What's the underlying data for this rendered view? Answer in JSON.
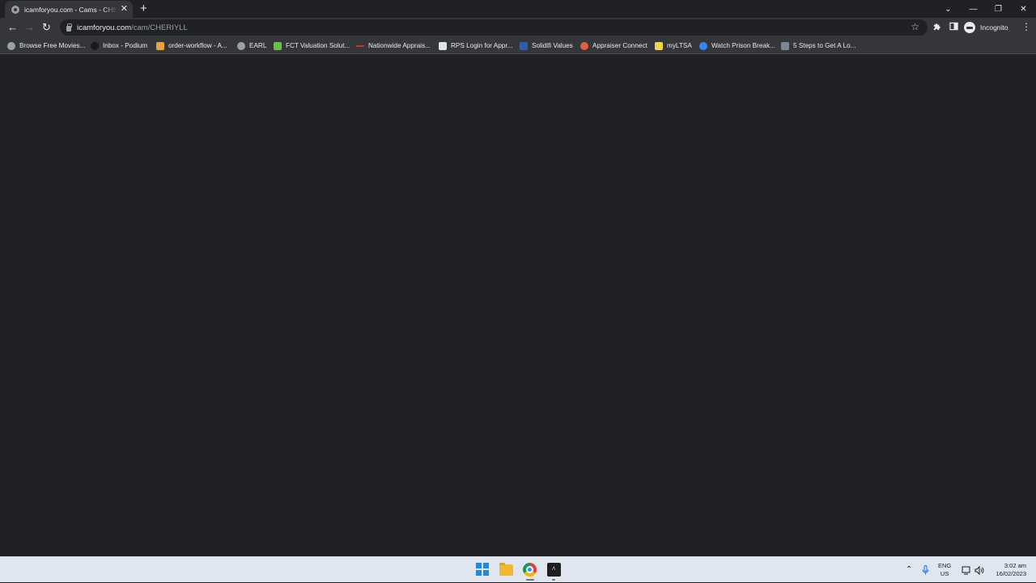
{
  "tab": {
    "title": "icamforyou.com - Cams - CHERIYLL",
    "close_glyph": "✕",
    "favicon": "globe-icon"
  },
  "new_tab_glyph": "+",
  "window_controls": {
    "tabsearch": "⌄",
    "minimize": "—",
    "restore": "❐",
    "close": "✕"
  },
  "toolbar": {
    "back": "←",
    "forward": "→",
    "reload": "↻",
    "url_host": "icamforyou.com",
    "url_path": "/cam/CHERIYLL",
    "star": "☆",
    "incognito_label": "Incognito",
    "menu": "⋮"
  },
  "bookmarks": [
    {
      "label": "Browse Free Movies...",
      "icon": "globe-icon",
      "color": "#9aa0a6"
    },
    {
      "label": "Inbox - Podium",
      "icon": "podium-icon",
      "color": "#1a1a1a"
    },
    {
      "label": "order-workflow - A...",
      "icon": "workflow-icon",
      "color": "#e8a33d"
    },
    {
      "label": "EARL",
      "icon": "globe-icon",
      "color": "#9aa0a6"
    },
    {
      "label": "FCT Valuation Solut...",
      "icon": "fct-icon",
      "color": "#6bbf4e"
    },
    {
      "label": "Nationwide Apprais...",
      "icon": "nationwide-icon",
      "color": "#c0392b"
    },
    {
      "label": "RPS Login for Appr...",
      "icon": "document-icon",
      "color": "#dfe3ea"
    },
    {
      "label": "Solidifi Values",
      "icon": "solidifi-icon",
      "color": "#2f5fa8"
    },
    {
      "label": "Appraiser Connect",
      "icon": "appraiser-icon",
      "color": "#e0623a"
    },
    {
      "label": "myLTSA",
      "icon": "ltsa-icon",
      "color": "#f3d34a"
    },
    {
      "label": "Watch Prison Break...",
      "icon": "play-icon",
      "color": "#3b82f6"
    },
    {
      "label": "5 Steps to Get A Lo...",
      "icon": "steps-icon",
      "color": "#7b8794"
    }
  ],
  "taskbar": {
    "lang_top": "ENG",
    "lang_bottom": "US",
    "time": "3:02 am",
    "date": "16/02/2023",
    "tray_up": "⌃",
    "mic": "🎙",
    "speaker": "🔊",
    "terminal_glyph": "⁄\\"
  }
}
